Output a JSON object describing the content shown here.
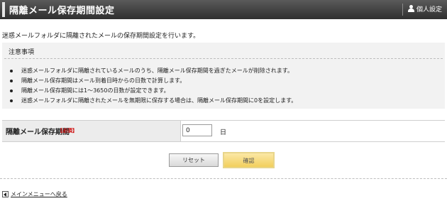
{
  "header": {
    "title": "隔離メール保存期間設定",
    "personal_settings": "個人設定",
    "personal_icon": "person-icon"
  },
  "description": "迷惑メールフォルダに隔離されたメールの保存期間設定を行います。",
  "notice": {
    "heading": "注意事項",
    "items": [
      "迷惑メールフォルダに隔離されているメールのうち、隔離メール保存期間を過ぎたメールが削除されます。",
      "隔離メール保存期間はメール到着日時からの日数で計算します。",
      "隔離メール保存期間には1～3650の日数が設定できます。",
      "迷惑メールフォルダに隔離されたメールを無期限に保存する場合は、隔離メール保存期間に0を設定します。"
    ]
  },
  "form": {
    "label": "隔離メール保存期間",
    "required": "【必須】",
    "value": "0",
    "unit": "日"
  },
  "buttons": {
    "reset": "リセット",
    "confirm": "確認"
  },
  "footer": {
    "back_link": "メインメニューへ戻る"
  }
}
